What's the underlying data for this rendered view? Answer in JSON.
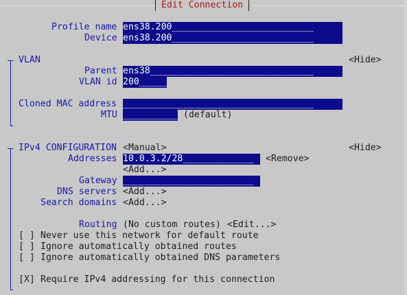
{
  "window": {
    "title": "Edit Connection"
  },
  "profile": {
    "profile_name_label": "Profile name",
    "profile_name_value": "ens38.200__________________________",
    "device_label": "Device",
    "device_value": "ens38.200__________________________"
  },
  "vlan": {
    "section_label": "VLAN",
    "toggle": "<Hide>",
    "parent_label": "Parent",
    "parent_value": "ens38______________________________",
    "vlan_id_label": "VLAN id",
    "vlan_id_value": "200_____",
    "cloned_mac_label": "Cloned MAC address",
    "cloned_mac_value": "___________________________________",
    "mtu_label": "MTU",
    "mtu_value": "__________",
    "mtu_hint": "(default)"
  },
  "ipv4": {
    "section_label": "IPv4 CONFIGURATION",
    "method": "<Manual>",
    "toggle": "<Hide>",
    "addresses_label": "Addresses",
    "address_value": "10.0.3.2/28_____________",
    "remove_button": "<Remove>",
    "add_address": "<Add...>",
    "gateway_label": "Gateway",
    "gateway_value": "________________________",
    "dns_label": "DNS servers",
    "dns_add": "<Add...>",
    "search_label": "Search domains",
    "search_add": "<Add...>",
    "routing_label": "Routing",
    "routing_value": "(No custom routes)",
    "routing_edit": "<Edit...>",
    "opt_never_default": {
      "box": "[ ]",
      "label": "Never use this network for default route"
    },
    "opt_ignore_routes": {
      "box": "[ ]",
      "label": "Ignore automatically obtained routes"
    },
    "opt_ignore_dns": {
      "box": "[ ]",
      "label": "Ignore automatically obtained DNS parameters"
    },
    "opt_require_ipv4": {
      "box": "[X]",
      "label": "Require IPv4 addressing for this connection"
    }
  },
  "colors": {
    "background": "#c8c8c8",
    "label_blue": "#1818b0",
    "field_bg": "#0b0b8c",
    "field_text": "#ffffff",
    "title_red": "#b01818"
  }
}
